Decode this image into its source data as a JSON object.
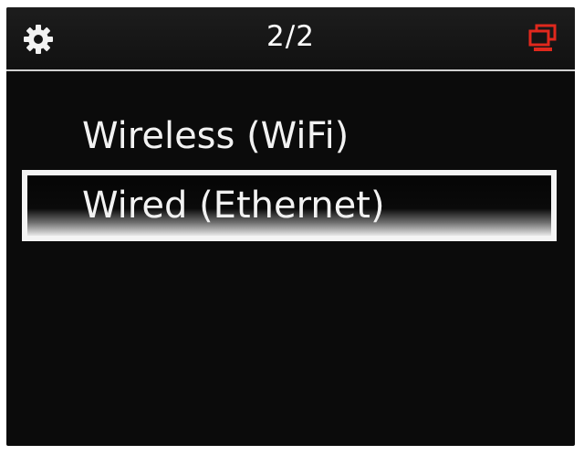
{
  "header": {
    "settings_icon": "gear-icon",
    "page_indicator": "2/2",
    "device_icon": "stacked-screens-icon",
    "device_icon_color": "#e0281d"
  },
  "menu": {
    "items": [
      {
        "label": "Wireless (WiFi)",
        "selected": false
      },
      {
        "label": "Wired (Ethernet)",
        "selected": true
      }
    ]
  },
  "colors": {
    "background": "#0b0b0b",
    "text": "#f4f4f4",
    "selection_border": "#f4f4f4",
    "divider": "#d0d0d0"
  }
}
